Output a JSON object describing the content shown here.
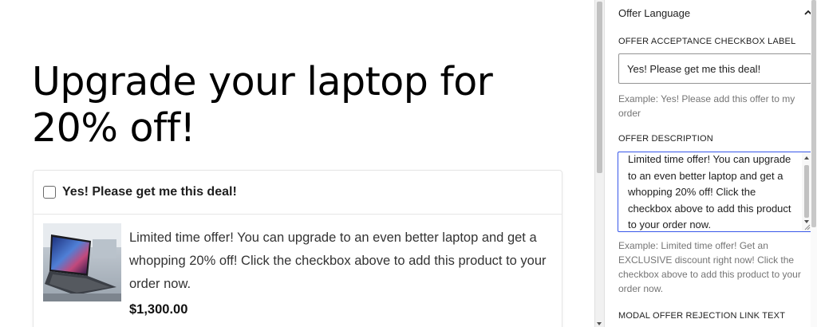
{
  "canvas": {
    "heading": "Upgrade your laptop for 20% off!",
    "offer": {
      "checkbox_label": "Yes! Please get me this deal!",
      "description": "Limited time offer! You can upgrade to an even better laptop and get a whopping 20% off! Click the checkbox above to add this product to your order now.",
      "price": "$1,300.00",
      "checked": false
    }
  },
  "sidebar": {
    "panel_title": "Offer Language",
    "panel_icon": "chevron-up-icon",
    "checkbox_label_field": {
      "label": "OFFER ACCEPTANCE CHECKBOX LABEL",
      "value": "Yes! Please get me this deal!",
      "help": "Example: Yes! Please add this offer to my order"
    },
    "description_field": {
      "label": "OFFER DESCRIPTION",
      "value": "Limited time offer! You can upgrade to an even better laptop and get a whopping 20% off! Click the checkbox above to add this product to your order now.",
      "help": "Example: Limited time offer! Get an EXCLUSIVE discount right now! Click the checkbox above to add this product to your order now."
    },
    "next_section_label": "MODAL OFFER REJECTION LINK TEXT"
  },
  "colors": {
    "focus_border": "#3858e9",
    "help_text": "#757575",
    "text": "#1e1e1e"
  }
}
